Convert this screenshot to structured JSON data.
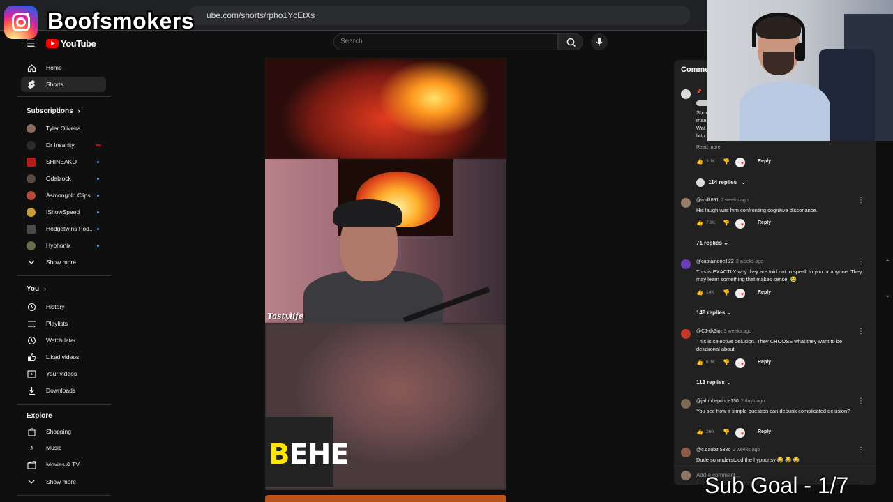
{
  "browser": {
    "url_fragment": "ube.com/shorts/rpho1YcEtXs"
  },
  "overlay": {
    "instagram_handle": "Boofsmokers",
    "sub_goal": "Sub Goal - 1/7"
  },
  "header": {
    "logo_text": "YouTube",
    "search_placeholder": "Search"
  },
  "sidebar": {
    "main": [
      {
        "label": "Home",
        "icon": "home-icon"
      },
      {
        "label": "Shorts",
        "icon": "shorts-icon",
        "active": true
      }
    ],
    "subscriptions_title": "Subscriptions",
    "subscriptions": [
      {
        "label": "Tyler Oliveira",
        "color": "#8a6d5e"
      },
      {
        "label": "Dr Insanity",
        "color": "#2b2b2b",
        "live": true
      },
      {
        "label": "SHINEAKO",
        "color": "#b01d1d",
        "dot": true
      },
      {
        "label": "Odablock",
        "color": "#5a4a3e",
        "dot": true
      },
      {
        "label": "Asmongold Clips",
        "color": "#b54a3a",
        "dot": true
      },
      {
        "label": "IShowSpeed",
        "color": "#c99a3a",
        "dot": true
      },
      {
        "label": "Hodgetwins Pod...",
        "color": "#4a4a4a",
        "dot": true
      },
      {
        "label": "Hyphonix",
        "color": "#6b6a4a",
        "dot": true
      }
    ],
    "show_more_1": "Show more",
    "you_title": "You",
    "you": [
      {
        "label": "History",
        "icon": "history-icon"
      },
      {
        "label": "Playlists",
        "icon": "playlists-icon"
      },
      {
        "label": "Watch later",
        "icon": "watch-later-icon"
      },
      {
        "label": "Liked videos",
        "icon": "thumbs-up-icon"
      },
      {
        "label": "Your videos",
        "icon": "your-videos-icon"
      },
      {
        "label": "Downloads",
        "icon": "download-icon"
      }
    ],
    "explore_title": "Explore",
    "explore": [
      {
        "label": "Shopping",
        "icon": "shopping-bag-icon"
      },
      {
        "label": "Music",
        "icon": "music-note-icon"
      },
      {
        "label": "Movies & TV",
        "icon": "clapperboard-icon"
      }
    ],
    "show_more_2": "Show more"
  },
  "video": {
    "watermark": "Tastylife",
    "caption_first_letter": "B",
    "caption_rest": "EHE"
  },
  "comments": {
    "title": "Comme",
    "pinned": {
      "text_lines": [
        "Shor",
        "man",
        "Wat",
        "http"
      ],
      "read_more": "Read more",
      "likes": "3.1K",
      "reply": "Reply",
      "replies": "114 replies"
    },
    "items": [
      {
        "user": "@rodk891",
        "ago": "2 weeks ago",
        "text": "His laugh was him confronting cognitive dissonance.",
        "likes": "7.9K",
        "reply": "Reply",
        "replies": "71 replies",
        "avatar_color": "#9a7c6a"
      },
      {
        "user": "@captainoneill22",
        "ago": "3 weeks ago",
        "text": "This is EXACTLY why they are told not to speak to you or anyone. They may learn something that makes sense. 😂",
        "likes": "14K",
        "reply": "Reply",
        "replies": "148 replies",
        "avatar_color": "#6a3fb5"
      },
      {
        "user": "@CJ-dk3im",
        "ago": "3 weeks ago",
        "text": "This is selective delusion. They CHOOSE what they want to be delusional about.",
        "likes": "6.1K",
        "reply": "Reply",
        "replies": "113 replies",
        "avatar_color": "#c0392b"
      },
      {
        "user": "@jahmbeprince130",
        "ago": "2 days ago",
        "text": "You see how a simple question can debunk complicated delusion?",
        "likes": "260",
        "reply": "Reply",
        "replies": "",
        "avatar_color": "#7a6a55"
      },
      {
        "user": "@c.daubz.5386",
        "ago": "2 weeks ago",
        "text": "Dude so understood the hypocrisy 😂 😂 😂",
        "likes": "",
        "reply": "",
        "replies": "",
        "avatar_color": "#8a5a4a"
      }
    ],
    "add_comment_placeholder": "Add a comment..."
  }
}
